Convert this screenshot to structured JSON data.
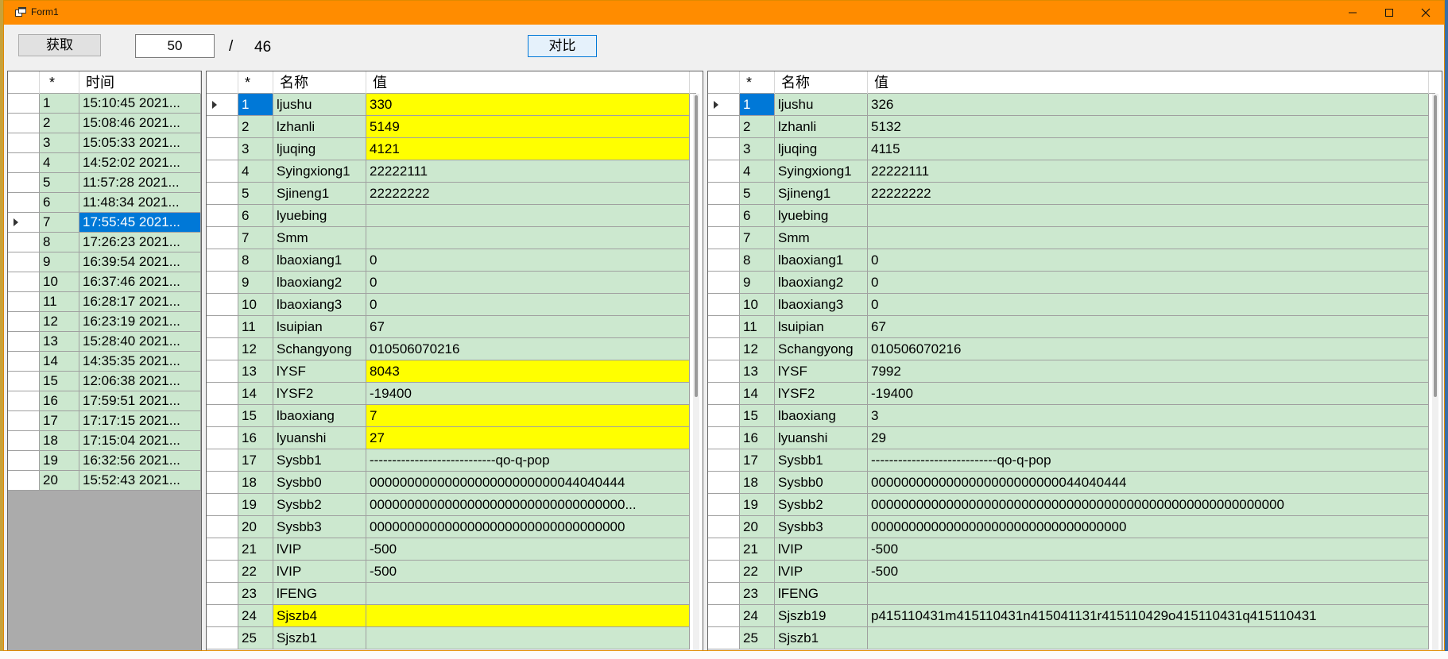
{
  "window": {
    "title": "Form1",
    "minimize_icon": "minimize-icon",
    "maximize_icon": "maximize-icon",
    "close_icon": "close-icon"
  },
  "toolbar": {
    "fetch_label": "获取",
    "count_value": "50",
    "separator": "/",
    "total": "46",
    "compare_label": "对比"
  },
  "left_list": {
    "headers": [
      "*",
      "时间"
    ],
    "selected_index": 7,
    "rows": [
      {
        "n": "1",
        "t": "15:10:45 2021..."
      },
      {
        "n": "2",
        "t": "15:08:46 2021..."
      },
      {
        "n": "3",
        "t": "15:05:33 2021..."
      },
      {
        "n": "4",
        "t": "14:52:02 2021..."
      },
      {
        "n": "5",
        "t": "11:57:28 2021..."
      },
      {
        "n": "6",
        "t": "11:48:34 2021..."
      },
      {
        "n": "7",
        "t": "17:55:45 2021..."
      },
      {
        "n": "8",
        "t": "17:26:23 2021..."
      },
      {
        "n": "9",
        "t": "16:39:54 2021..."
      },
      {
        "n": "10",
        "t": "16:37:46 2021..."
      },
      {
        "n": "11",
        "t": "16:28:17 2021..."
      },
      {
        "n": "12",
        "t": "16:23:19 2021..."
      },
      {
        "n": "13",
        "t": "15:28:40 2021..."
      },
      {
        "n": "14",
        "t": "14:35:35 2021..."
      },
      {
        "n": "15",
        "t": "12:06:38 2021..."
      },
      {
        "n": "16",
        "t": "17:59:51 2021..."
      },
      {
        "n": "17",
        "t": "17:17:15 2021..."
      },
      {
        "n": "18",
        "t": "17:15:04 2021..."
      },
      {
        "n": "19",
        "t": "16:32:56 2021..."
      },
      {
        "n": "20",
        "t": "15:52:43 2021..."
      }
    ]
  },
  "middle_grid": {
    "headers": [
      "*",
      "名称",
      "值"
    ],
    "rows": [
      {
        "n": "1",
        "name": "ljushu",
        "value": "330",
        "hl": true
      },
      {
        "n": "2",
        "name": "lzhanli",
        "value": "5149",
        "hl": true
      },
      {
        "n": "3",
        "name": "ljuqing",
        "value": "4121",
        "hl": true
      },
      {
        "n": "4",
        "name": "Syingxiong1",
        "value": "22222111",
        "hl": false
      },
      {
        "n": "5",
        "name": "Sjineng1",
        "value": "22222222",
        "hl": false
      },
      {
        "n": "6",
        "name": "lyuebing",
        "value": "",
        "hl": false
      },
      {
        "n": "7",
        "name": "Smm",
        "value": "",
        "hl": false
      },
      {
        "n": "8",
        "name": "lbaoxiang1",
        "value": "0",
        "hl": false
      },
      {
        "n": "9",
        "name": "lbaoxiang2",
        "value": "0",
        "hl": false
      },
      {
        "n": "10",
        "name": "lbaoxiang3",
        "value": "0",
        "hl": false
      },
      {
        "n": "11",
        "name": "lsuipian",
        "value": "67",
        "hl": false
      },
      {
        "n": "12",
        "name": "Schangyong",
        "value": "010506070216",
        "hl": false
      },
      {
        "n": "13",
        "name": "lYSF",
        "value": "8043",
        "hl": true
      },
      {
        "n": "14",
        "name": "lYSF2",
        "value": "-19400",
        "hl": false
      },
      {
        "n": "15",
        "name": "lbaoxiang",
        "value": "7",
        "hl": true
      },
      {
        "n": "16",
        "name": "lyuanshi",
        "value": "27",
        "hl": true
      },
      {
        "n": "17",
        "name": "Sysbb1",
        "value": "----------------------------qo-q-pop",
        "hl": false
      },
      {
        "n": "18",
        "name": "Sysbb0",
        "value": "0000000000000000000000000044040444",
        "hl": false
      },
      {
        "n": "19",
        "name": "Sysbb2",
        "value": "0000000000000000000000000000000000...",
        "hl": false
      },
      {
        "n": "20",
        "name": "Sysbb3",
        "value": "0000000000000000000000000000000000",
        "hl": false
      },
      {
        "n": "21",
        "name": "lVIP",
        "value": "-500",
        "hl": false
      },
      {
        "n": "22",
        "name": "lVIP",
        "value": "-500",
        "hl": false
      },
      {
        "n": "23",
        "name": "lFENG",
        "value": "",
        "hl": false
      },
      {
        "n": "24",
        "name": "Sjszb4",
        "value": "",
        "hl": true,
        "name_hl": true
      },
      {
        "n": "25",
        "name": "Sjszb1",
        "value": "",
        "hl": false
      }
    ]
  },
  "right_grid": {
    "headers": [
      "*",
      "名称",
      "值"
    ],
    "rows": [
      {
        "n": "1",
        "name": "ljushu",
        "value": "326"
      },
      {
        "n": "2",
        "name": "lzhanli",
        "value": "5132"
      },
      {
        "n": "3",
        "name": "ljuqing",
        "value": "4115"
      },
      {
        "n": "4",
        "name": "Syingxiong1",
        "value": "22222111"
      },
      {
        "n": "5",
        "name": "Sjineng1",
        "value": "22222222"
      },
      {
        "n": "6",
        "name": "lyuebing",
        "value": ""
      },
      {
        "n": "7",
        "name": "Smm",
        "value": ""
      },
      {
        "n": "8",
        "name": "lbaoxiang1",
        "value": "0"
      },
      {
        "n": "9",
        "name": "lbaoxiang2",
        "value": "0"
      },
      {
        "n": "10",
        "name": "lbaoxiang3",
        "value": "0"
      },
      {
        "n": "11",
        "name": "lsuipian",
        "value": "67"
      },
      {
        "n": "12",
        "name": "Schangyong",
        "value": "010506070216"
      },
      {
        "n": "13",
        "name": "lYSF",
        "value": "7992"
      },
      {
        "n": "14",
        "name": "lYSF2",
        "value": "-19400"
      },
      {
        "n": "15",
        "name": "lbaoxiang",
        "value": "3"
      },
      {
        "n": "16",
        "name": "lyuanshi",
        "value": "29"
      },
      {
        "n": "17",
        "name": "Sysbb1",
        "value": "----------------------------qo-q-pop"
      },
      {
        "n": "18",
        "name": "Sysbb0",
        "value": "0000000000000000000000000044040444"
      },
      {
        "n": "19",
        "name": "Sysbb2",
        "value": "0000000000000000000000000000000000000000000000000000000"
      },
      {
        "n": "20",
        "name": "Sysbb3",
        "value": "0000000000000000000000000000000000"
      },
      {
        "n": "21",
        "name": "lVIP",
        "value": "-500"
      },
      {
        "n": "22",
        "name": "lVIP",
        "value": "-500"
      },
      {
        "n": "23",
        "name": "lFENG",
        "value": ""
      },
      {
        "n": "24",
        "name": "Sjszb19",
        "value": "p415110431m415110431n415041131r415110429o415110431q415110431"
      },
      {
        "n": "25",
        "name": "Sjszb1",
        "value": ""
      }
    ]
  },
  "colors": {
    "titlebar": "#ff8c00",
    "row_green": "#cce8cf",
    "highlight_yellow": "#ffff00",
    "selection_blue": "#0078d7"
  }
}
